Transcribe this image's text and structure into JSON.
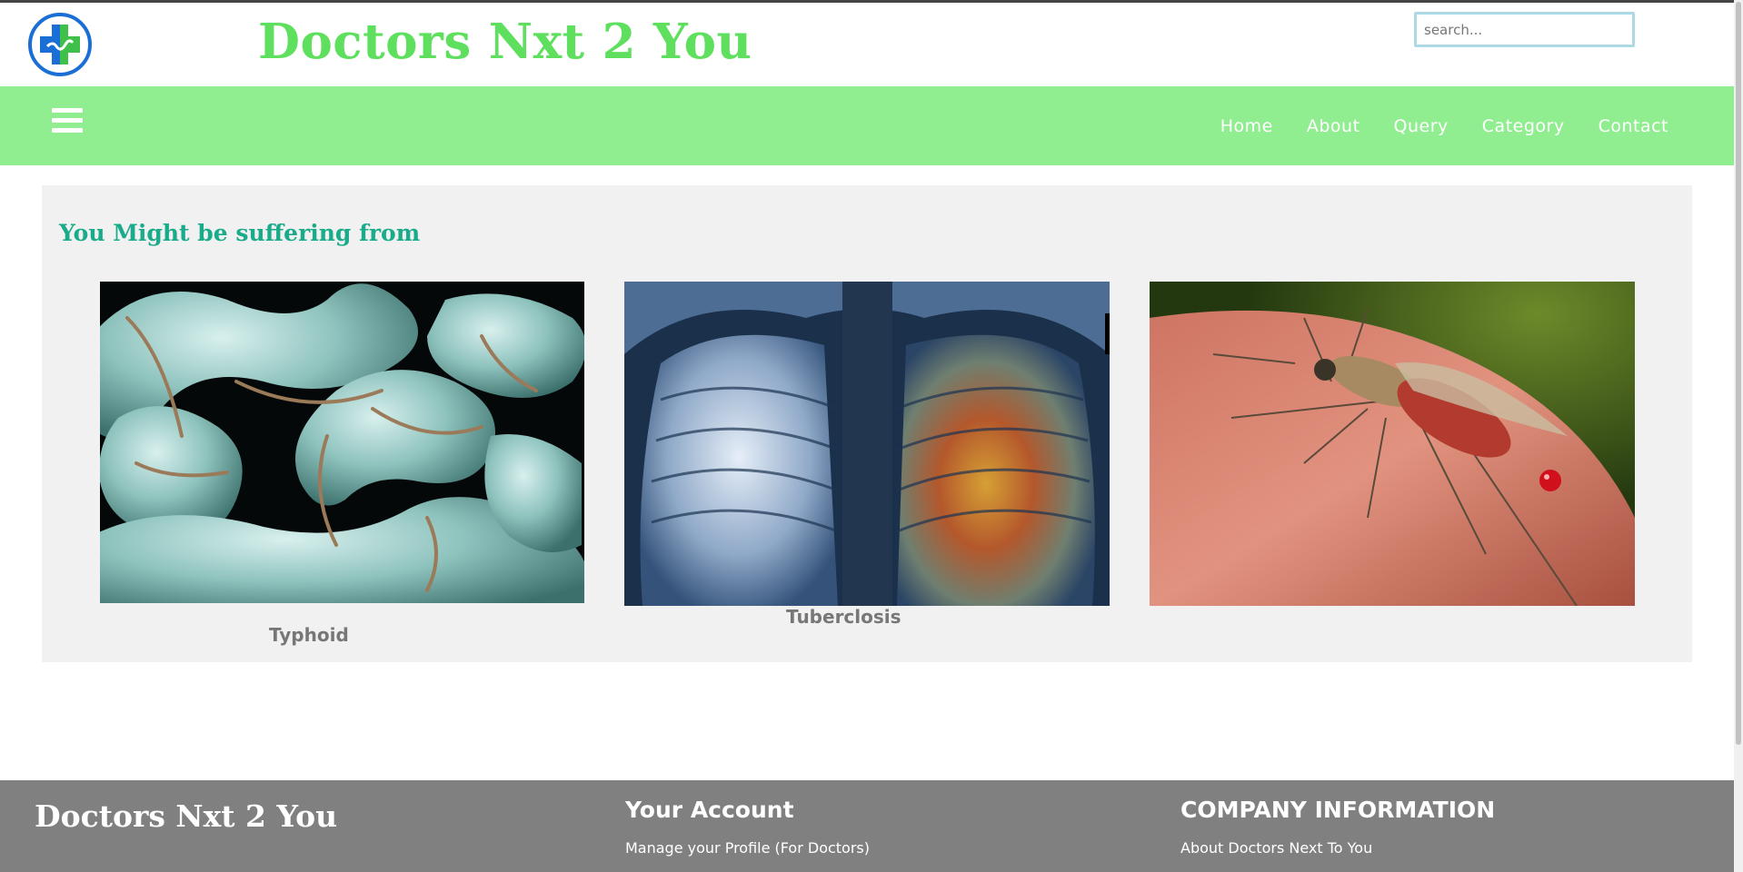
{
  "header": {
    "site_title": "Doctors Nxt 2 You",
    "search_placeholder": "search...",
    "search_value": ""
  },
  "nav": {
    "items": [
      {
        "label": "Home"
      },
      {
        "label": "About"
      },
      {
        "label": "Query"
      },
      {
        "label": "Category"
      },
      {
        "label": "Contact"
      }
    ]
  },
  "main": {
    "heading": "You Might be suffering from",
    "cards": [
      {
        "label": "Typhoid",
        "image": "bacteria-micrograph"
      },
      {
        "label": "Tuberclosis",
        "image": "chest-xray"
      },
      {
        "label": "",
        "image": "mosquito-on-skin"
      }
    ]
  },
  "footer": {
    "brand": "Doctors Nxt 2 You",
    "account": {
      "heading": "Your Account",
      "links": [
        "Manage your Profile (For Doctors)"
      ]
    },
    "company": {
      "heading": "COMPANY INFORMATION",
      "links": [
        "About Doctors Next To You"
      ]
    }
  },
  "colors": {
    "title_green": "#5ee05e",
    "nav_bg": "#90ee90",
    "heading_teal": "#1aab8a",
    "panel_bg": "#f1f1f1",
    "footer_bg": "#808080"
  }
}
